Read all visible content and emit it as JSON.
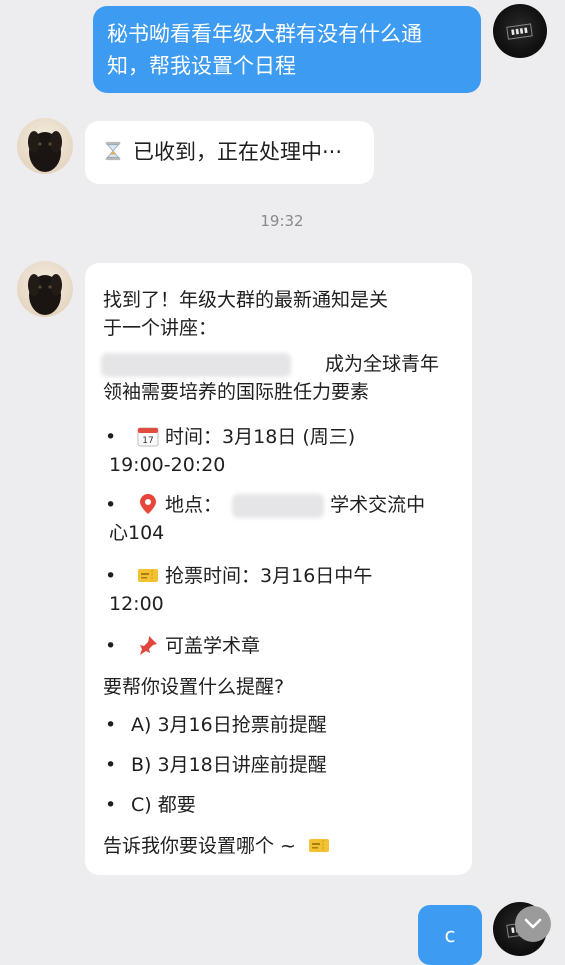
{
  "messages": {
    "user_request": "秘书呦看看年级大群有没有什么通知，帮我设置个日程",
    "user_request_line1": "秘书呦看看年级大群有没有什么通",
    "user_request_line2": "知，帮我设置个日程",
    "bot_ack": "已收到，正在处理中···",
    "timestamp": "19:32",
    "reply": {
      "line1": "找到了！年级大群的最新通知是关",
      "line2": "于一个讲座：",
      "topic_line1": "成为全球青年",
      "topic_line2": "领袖需要培养的国际胜任力要素",
      "time_label": "时间：3月18日 (周三)",
      "time_value": "19:00-20:20",
      "place_label": "地点：",
      "place_suffix": "学术交流中",
      "place_line2": "心104",
      "ticket_label": "抢票时间：3月16日中午",
      "ticket_value": "12:00",
      "stamp_label": "可盖学术章",
      "question": "要帮你设置什么提醒?",
      "option_a": "A) 3月16日抢票前提醒",
      "option_b": "B) 3月18日讲座前提醒",
      "option_c": "C) 都要",
      "closing": "告诉我你要设置哪个 ~"
    },
    "user_choice": "c"
  },
  "bullet": "•",
  "icons": {
    "hourglass": "hourglass-icon",
    "calendar": "calendar-icon",
    "pin": "location-pin-icon",
    "ticket": "ticket-icon",
    "pushpin": "pushpin-icon",
    "scroll_down": "chevron-down-icon"
  },
  "colors": {
    "background": "#ededf0",
    "user_bubble": "#3d9cf1",
    "bot_bubble": "#ffffff",
    "timestamp": "#8a8a8a"
  }
}
